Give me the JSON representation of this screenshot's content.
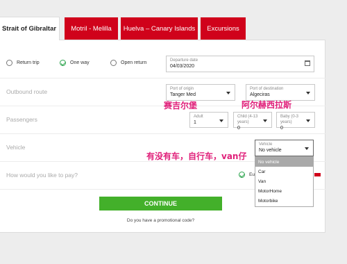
{
  "tabs": [
    {
      "label": "Strait of Gibraltar"
    },
    {
      "label": "Motril - Melilla"
    },
    {
      "label": "Huelva – Canary Islands"
    },
    {
      "label": "Excursions"
    }
  ],
  "trip_type": {
    "return_trip": "Return trip",
    "one_way": "One way",
    "open_return": "Open return",
    "selected": "One way"
  },
  "departure": {
    "label": "Departure date",
    "value": "04/03/2020"
  },
  "outbound": {
    "section_label": "Outbound route",
    "origin_label": "Port of origin",
    "origin_value": "Tanger Med",
    "destination_label": "Port of destination",
    "destination_value": "Algeciras"
  },
  "passengers": {
    "section_label": "Passengers",
    "adult_label": "Adult",
    "adult_value": "1",
    "child_label": "Child (4-13 years)",
    "child_value": "0",
    "baby_label": "Baby (0-3 years)",
    "baby_value": "0"
  },
  "vehicle": {
    "section_label": "Vehicle",
    "field_label": "Vehicle",
    "field_value": "No vehicle",
    "options": [
      "No vehicle",
      "Car",
      "Van",
      "MotorHome",
      "Motorbike"
    ],
    "selected_index": 0
  },
  "payment": {
    "section_label": "How would you like to pay?",
    "option_partial": "Eu"
  },
  "annotations": {
    "origin_cn": "赛吉尔堡",
    "destination_cn": "阿尔赫西拉斯",
    "vehicle_cn": "有没有车，自行车，van仔"
  },
  "actions": {
    "continue_label": "CONTINUE",
    "promo_label": "Do you have a promotional code?"
  },
  "colors": {
    "brand_red": "#d0021b",
    "continue_green": "#43b02a",
    "annotation_pink": "#e0207a"
  }
}
